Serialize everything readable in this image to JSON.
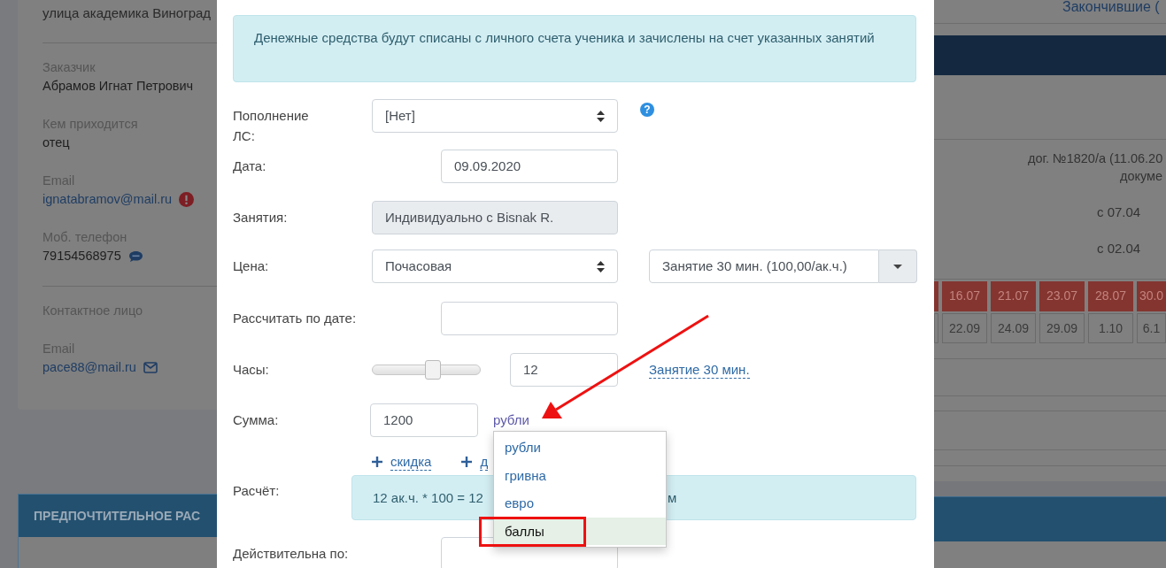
{
  "background": {
    "left_card": {
      "address_value": "улица академика Виноград",
      "groups": [
        [
          {
            "label": "Заказчик",
            "value": "Абрамов Игнат Петрович",
            "kind": "text"
          },
          {
            "label": "Кем приходится",
            "value": "отец",
            "kind": "text"
          },
          {
            "label": "Email",
            "value": "ignatabramov@mail.ru",
            "kind": "email_warning"
          },
          {
            "label": "Моб. телефон",
            "value": "79154568975",
            "kind": "phone_sms"
          }
        ],
        [
          {
            "label": "Контактное лицо",
            "kind": "heading"
          },
          {
            "label": "Email",
            "value": "pace88@mail.ru",
            "kind": "email_mail"
          }
        ]
      ],
      "section_title": "ПРЕДПОЧТИТЕЛЬНОЕ РАС"
    },
    "right_panel": {
      "top_link": "Закончившие (",
      "contract": "дог. №1820/а (11.06.20",
      "document": "докуме",
      "starts": [
        "с 07.04",
        "с 02.04"
      ],
      "red_row": [
        "16.07",
        "21.07",
        "23.07",
        "28.07",
        "30.0"
      ],
      "gray_row": [
        "22.09",
        "24.09",
        "29.09",
        "1.10",
        "6.1"
      ]
    }
  },
  "modal": {
    "notice": "Денежные средства будут списаны с личного счета ученика и зачислены на счет указанных занятий",
    "rows": [
      {
        "kind": "select",
        "label": "Пополнение ЛС:",
        "value": "[Нет]",
        "help": "?"
      },
      {
        "kind": "input",
        "label": "Дата:",
        "value": "09.09.2020"
      },
      {
        "kind": "readonly",
        "label": "Занятия:",
        "value": "Индивидуально с Bisnak R."
      },
      {
        "kind": "price",
        "label": "Цена:",
        "value": "Почасовая",
        "tariff": "Занятие 30 мин. (100,00/ак.ч.)"
      },
      {
        "kind": "input",
        "label": "Рассчитать по дате:"
      },
      {
        "kind": "hours",
        "label": "Часы:",
        "level": 0.57,
        "value": "12",
        "link": "Занятие 30 мин."
      },
      {
        "kind": "amount",
        "label": "Сумма:",
        "value": "1200",
        "currency": "рубли"
      },
      {
        "kind": "links",
        "links": [
          "скидка",
          "д"
        ]
      },
      {
        "kind": "calc",
        "label": "Расчёт:",
        "parts": [
          "12 ак.ч. * 100 = 12",
          "м"
        ]
      },
      {
        "kind": "input",
        "label": "Действительна по:"
      }
    ],
    "currency_menu": [
      {
        "label": "рубли",
        "selected": false
      },
      {
        "label": "гривна",
        "selected": false
      },
      {
        "label": "евро",
        "selected": false
      },
      {
        "label": "баллы",
        "selected": true
      }
    ]
  }
}
